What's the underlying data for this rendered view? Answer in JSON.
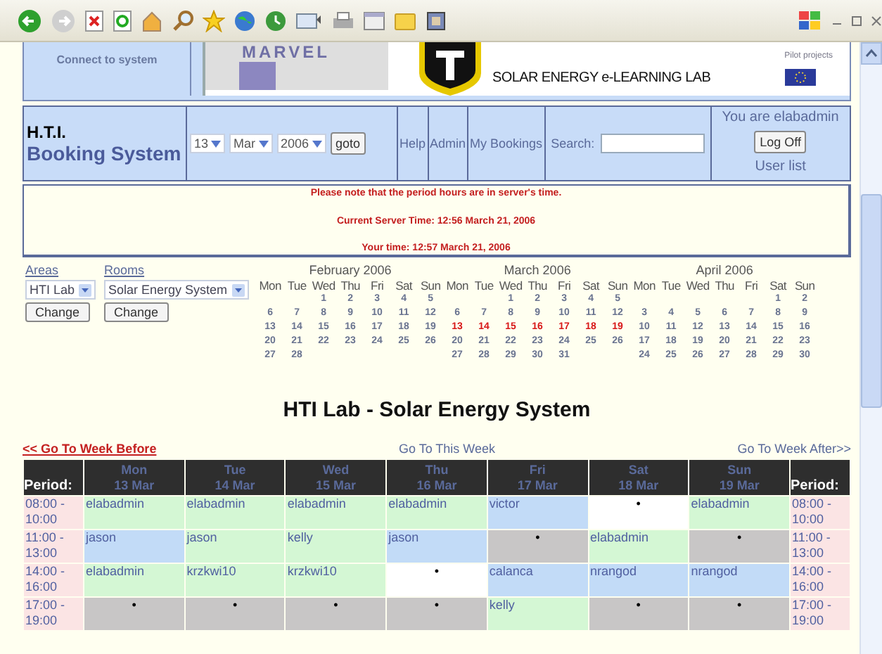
{
  "banner": {
    "left_link": "Connect to system",
    "logo_text": "MARVEL",
    "lab_title": "SOLAR ENERGY e-LEARNING LAB",
    "partner_caption": "Pilot projects"
  },
  "header": {
    "title_line1": "H.T.I.",
    "title_line2": "Booking System",
    "day": "13",
    "month": "Mar",
    "year": "2006",
    "goto_button": "goto",
    "links": [
      "Help",
      "Admin",
      "My Bookings"
    ],
    "search_label": "Search:",
    "user_text": "You are elabadmin",
    "logoff_button": "Log Off",
    "user_list_link": "User list"
  },
  "notice": [
    "Please note that the period hours are in server's time.",
    "Current Server Time: 12:56 March 21, 2006",
    "Your time: 12:57 March 21, 2006"
  ],
  "areas": {
    "label": "Areas",
    "value": "HTI Lab",
    "button": "Change"
  },
  "rooms": {
    "label": "Rooms",
    "value": "Solar Energy System",
    "button": "Change"
  },
  "calendars": [
    {
      "title": "February 2006",
      "weekdays": [
        "Mon",
        "Tue",
        "Wed",
        "Thu",
        "Fri",
        "Sat",
        "Sun"
      ],
      "weeks": [
        {
          "kind": "first",
          "selected": false,
          "days": [
            "1",
            "2",
            "3",
            "4",
            "5"
          ]
        },
        {
          "kind": "full",
          "selected": false,
          "days": [
            "6",
            "7",
            "8",
            "9",
            "10",
            "11",
            "12"
          ]
        },
        {
          "kind": "full",
          "selected": false,
          "days": [
            "13",
            "14",
            "15",
            "16",
            "17",
            "18",
            "19"
          ]
        },
        {
          "kind": "full",
          "selected": false,
          "days": [
            "20",
            "21",
            "22",
            "23",
            "24",
            "25",
            "26"
          ]
        },
        {
          "kind": "last",
          "selected": false,
          "days": [
            "27",
            "28"
          ]
        }
      ]
    },
    {
      "title": "March 2006",
      "weekdays": [
        "Mon",
        "Tue",
        "Wed",
        "Thu",
        "Fri",
        "Sat",
        "Sun"
      ],
      "weeks": [
        {
          "kind": "first",
          "selected": false,
          "days": [
            "1",
            "2",
            "3",
            "4",
            "5"
          ]
        },
        {
          "kind": "full",
          "selected": false,
          "days": [
            "6",
            "7",
            "8",
            "9",
            "10",
            "11",
            "12"
          ]
        },
        {
          "kind": "full",
          "selected": true,
          "days": [
            "13",
            "14",
            "15",
            "16",
            "17",
            "18",
            "19"
          ]
        },
        {
          "kind": "full",
          "selected": false,
          "days": [
            "20",
            "21",
            "22",
            "23",
            "24",
            "25",
            "26"
          ]
        },
        {
          "kind": "last",
          "selected": false,
          "days": [
            "27",
            "28",
            "29",
            "30",
            "31"
          ]
        }
      ]
    },
    {
      "title": "April 2006",
      "weekdays": [
        "Mon",
        "Tue",
        "Wed",
        "Thu",
        "Fri",
        "Sat",
        "Sun"
      ],
      "weeks": [
        {
          "kind": "first",
          "selected": false,
          "days": [
            "1",
            "2"
          ]
        },
        {
          "kind": "full",
          "selected": false,
          "days": [
            "3",
            "4",
            "5",
            "6",
            "7",
            "8",
            "9"
          ]
        },
        {
          "kind": "full",
          "selected": false,
          "days": [
            "10",
            "11",
            "12",
            "13",
            "14",
            "15",
            "16"
          ]
        },
        {
          "kind": "full",
          "selected": false,
          "days": [
            "17",
            "18",
            "19",
            "20",
            "21",
            "22",
            "23"
          ]
        },
        {
          "kind": "full",
          "selected": false,
          "days": [
            "24",
            "25",
            "26",
            "27",
            "28",
            "29",
            "30"
          ]
        }
      ]
    }
  ],
  "schedule_title": "HTI Lab - Solar Energy System",
  "week_nav": {
    "before": "<< Go To Week Before",
    "this": "Go To This Week",
    "after": "Go To Week After>>"
  },
  "table": {
    "period_heading": "Period:",
    "period_heading_right": "Period:",
    "days": [
      {
        "name": "Mon",
        "date": "13 Mar"
      },
      {
        "name": "Tue",
        "date": "14 Mar"
      },
      {
        "name": "Wed",
        "date": "15 Mar"
      },
      {
        "name": "Thu",
        "date": "16 Mar"
      },
      {
        "name": "Fri",
        "date": "17 Mar"
      },
      {
        "name": "Sat",
        "date": "18 Mar"
      },
      {
        "name": "Sun",
        "date": "19 Mar"
      }
    ],
    "rows": [
      {
        "period": "08:00 - 10:00",
        "period_right": "08:00 - 10:00",
        "cells": [
          {
            "text": "elabadmin",
            "color": "#d4f7d4"
          },
          {
            "text": "elabadmin",
            "color": "#d4f7d4"
          },
          {
            "text": "elabadmin",
            "color": "#d4f7d4"
          },
          {
            "text": "elabadmin",
            "color": "#d4f7d4"
          },
          {
            "text": "victor",
            "color": "#c2dbf7"
          },
          {
            "text": "•",
            "color": "#ffffff"
          },
          {
            "text": "elabadmin",
            "color": "#d4f7d4"
          }
        ]
      },
      {
        "period": "11:00 - 13:00",
        "period_right": "11:00 - 13:00",
        "cells": [
          {
            "text": "jason",
            "color": "#c2dbf7"
          },
          {
            "text": "jason",
            "color": "#d4f7d4"
          },
          {
            "text": "kelly",
            "color": "#d4f7d4"
          },
          {
            "text": "jason",
            "color": "#c2dbf7"
          },
          {
            "text": "•",
            "color": "#c8c6c6"
          },
          {
            "text": "elabadmin",
            "color": "#d4f7d4"
          },
          {
            "text": "•",
            "color": "#c8c6c6"
          }
        ]
      },
      {
        "period": "14:00 - 16:00",
        "period_right": "14:00 - 16:00",
        "cells": [
          {
            "text": "elabadmin",
            "color": "#d4f7d4"
          },
          {
            "text": "krzkwi10",
            "color": "#d4f7d4"
          },
          {
            "text": "krzkwi10",
            "color": "#d4f7d4"
          },
          {
            "text": "•",
            "color": "#ffffff"
          },
          {
            "text": "calanca",
            "color": "#c2dbf7"
          },
          {
            "text": "nrangod",
            "color": "#c2dbf7"
          },
          {
            "text": "nrangod",
            "color": "#c2dbf7"
          }
        ]
      },
      {
        "period": "17:00 - 19:00",
        "period_right": "17:00 - 19:00",
        "cells": [
          {
            "text": "•",
            "color": "#c8c6c6"
          },
          {
            "text": "•",
            "color": "#c8c6c6"
          },
          {
            "text": "•",
            "color": "#c8c6c6"
          },
          {
            "text": "•",
            "color": "#c8c6c6"
          },
          {
            "text": "kelly",
            "color": "#d4f7d4"
          },
          {
            "text": "•",
            "color": "#c8c6c6"
          },
          {
            "text": "•",
            "color": "#c8c6c6"
          }
        ]
      }
    ]
  }
}
